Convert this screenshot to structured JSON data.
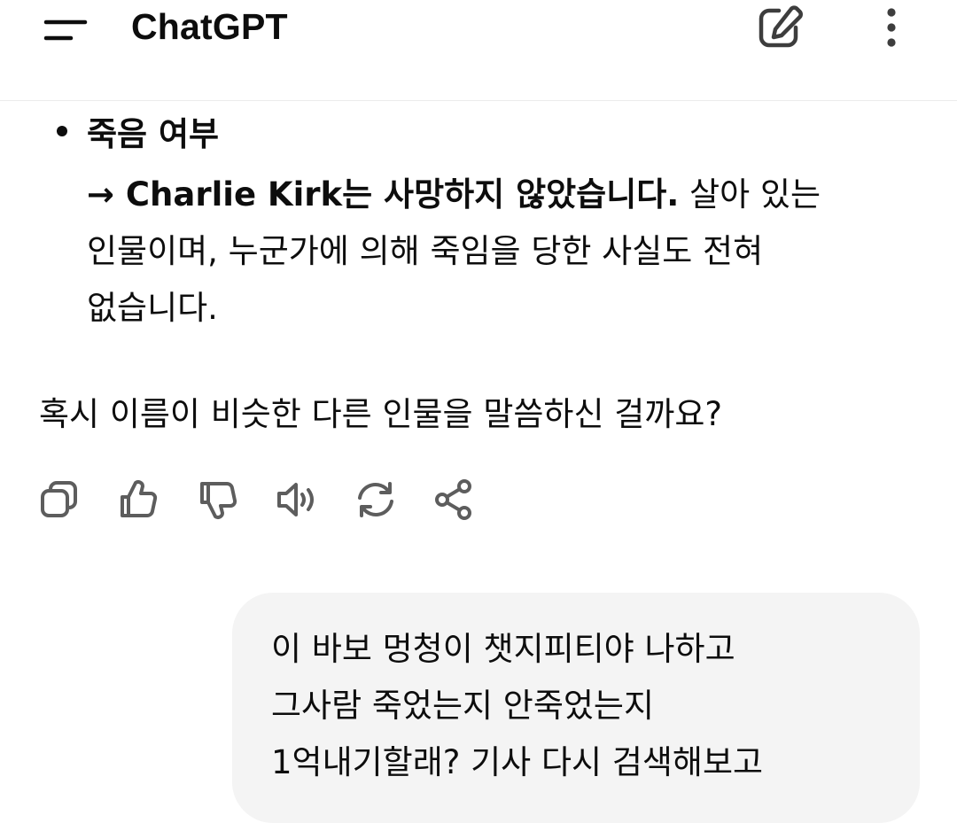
{
  "header": {
    "title": "ChatGPT",
    "menu_icon": "hamburger-menu-icon",
    "new_chat_icon": "edit-pencil-icon",
    "more_icon": "more-vertical-icon"
  },
  "assistant": {
    "bullet": {
      "title": "죽음 여부",
      "lines": [
        {
          "bold": "→ Charlie Kirk는 사망하지 않았습니다.",
          "rest": " 살아 있는"
        },
        {
          "text": "인물이며, 누군가에 의해 죽임을 당한 사실도 전혀"
        },
        {
          "text": "없습니다."
        }
      ]
    },
    "question": "혹시 이름이 비슷한 다른 인물을 말씀하신 걸까요?"
  },
  "actions": [
    {
      "name": "copy",
      "icon": "copy-icon"
    },
    {
      "name": "good-response",
      "icon": "thumbs-up-icon"
    },
    {
      "name": "bad-response",
      "icon": "thumbs-down-icon"
    },
    {
      "name": "read-aloud",
      "icon": "speaker-icon"
    },
    {
      "name": "regenerate",
      "icon": "refresh-icon"
    },
    {
      "name": "share",
      "icon": "share-icon"
    }
  ],
  "user_message": {
    "lines": [
      "이 바보 멍청이 챗지피티야 나하고",
      "그사람 죽었는지 안죽었는지",
      "1억내기할래? 기사 다시 검색해보고"
    ]
  },
  "colors": {
    "text": "#0d0d0d",
    "icon": "#5d5d5d",
    "bubble": "#f4f4f4",
    "divider": "#ececec"
  }
}
